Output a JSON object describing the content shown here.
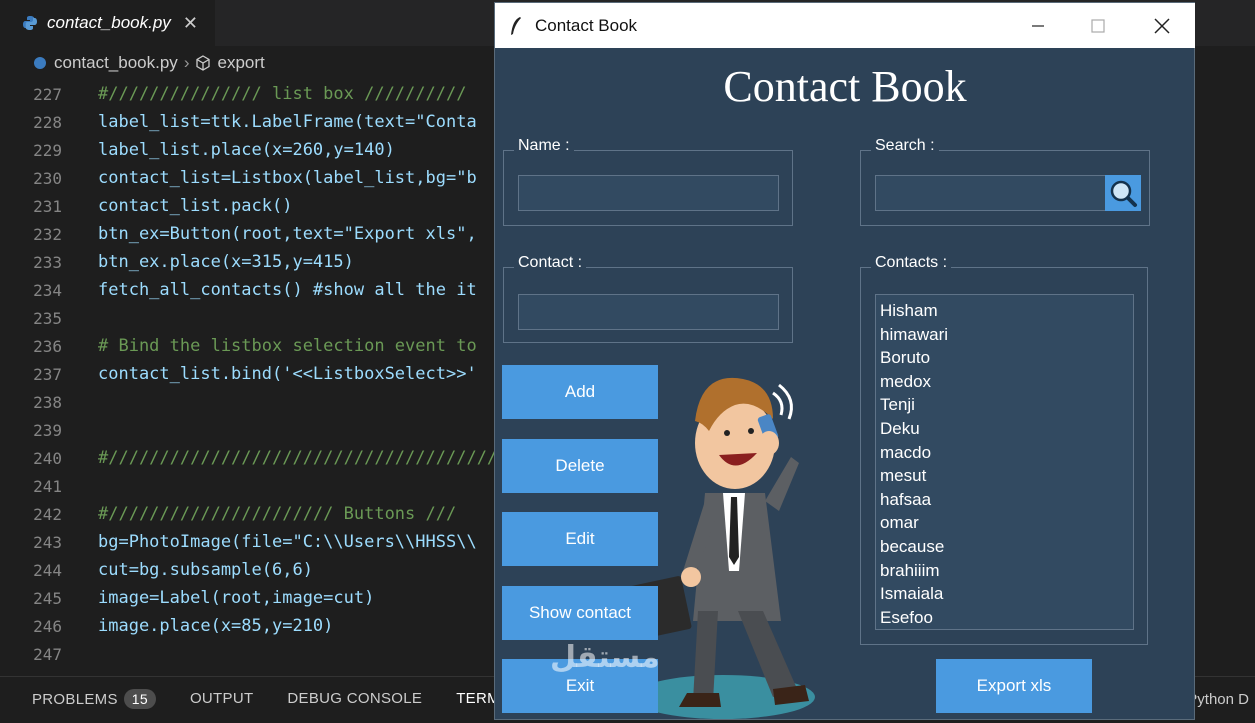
{
  "editor": {
    "tab_title": "contact_book.py",
    "tab_close": "✕",
    "breadcrumb": {
      "file": "contact_book.py",
      "sep": "›",
      "symbol": "export"
    },
    "lines": [
      {
        "n": "227",
        "t": "#/////////////// list box //////////"
      },
      {
        "n": "228",
        "t": "label_list=ttk.LabelFrame(text=\"Conta"
      },
      {
        "n": "229",
        "t": "label_list.place(x=260,y=140)"
      },
      {
        "n": "230",
        "t": "contact_list=Listbox(label_list,bg=\"b"
      },
      {
        "n": "231",
        "t": "contact_list.pack()"
      },
      {
        "n": "232",
        "t": "btn_ex=Button(root,text=\"Export xls\","
      },
      {
        "n": "233",
        "t": "btn_ex.place(x=315,y=415)"
      },
      {
        "n": "234",
        "t": "fetch_all_contacts() #show all the it"
      },
      {
        "n": "235",
        "t": ""
      },
      {
        "n": "236",
        "t": "# Bind the listbox selection event to"
      },
      {
        "n": "237",
        "t": "contact_list.bind('<<ListboxSelect>>'"
      },
      {
        "n": "238",
        "t": ""
      },
      {
        "n": "239",
        "t": ""
      },
      {
        "n": "240",
        "t": "#//////////////////////////////////////"
      },
      {
        "n": "241",
        "t": ""
      },
      {
        "n": "242",
        "t": "#////////////////////// Buttons ///"
      },
      {
        "n": "243",
        "t": "bg=PhotoImage(file=\"C:\\\\Users\\\\HHSS\\\\"
      },
      {
        "n": "244",
        "t": "cut=bg.subsample(6,6)"
      },
      {
        "n": "245",
        "t": "image=Label(root,image=cut)"
      },
      {
        "n": "246",
        "t": "image.place(x=85,y=210)"
      },
      {
        "n": "247",
        "t": ""
      }
    ],
    "panel": {
      "problems": "PROBLEMS",
      "problems_count": "15",
      "output": "OUTPUT",
      "debug": "DEBUG CONSOLE",
      "terminal": "TERMINAL",
      "status_right": "Python D"
    }
  },
  "app": {
    "window_title": "Contact Book",
    "heading": "Contact Book",
    "name_label": "Name  :",
    "contact_label": "Contact :",
    "search_label": "Search  :",
    "contacts_label": "Contacts :",
    "buttons": {
      "add": "Add",
      "delete": "Delete",
      "edit": "Edit",
      "show": "Show contact",
      "exit": "Exit",
      "export": "Export xls"
    },
    "contacts": [
      "Hisham",
      "himawari",
      "Boruto",
      "medox",
      "Tenji",
      "Deku",
      "macdo",
      "mesut",
      "hafsaa",
      "omar",
      "because",
      "brahiiim",
      "Ismaiala",
      "Esefoo"
    ],
    "colors": {
      "bg": "#2d4257",
      "button": "#4a9ae0",
      "titlebar": "#ffffff"
    }
  },
  "watermark": "مستقل"
}
